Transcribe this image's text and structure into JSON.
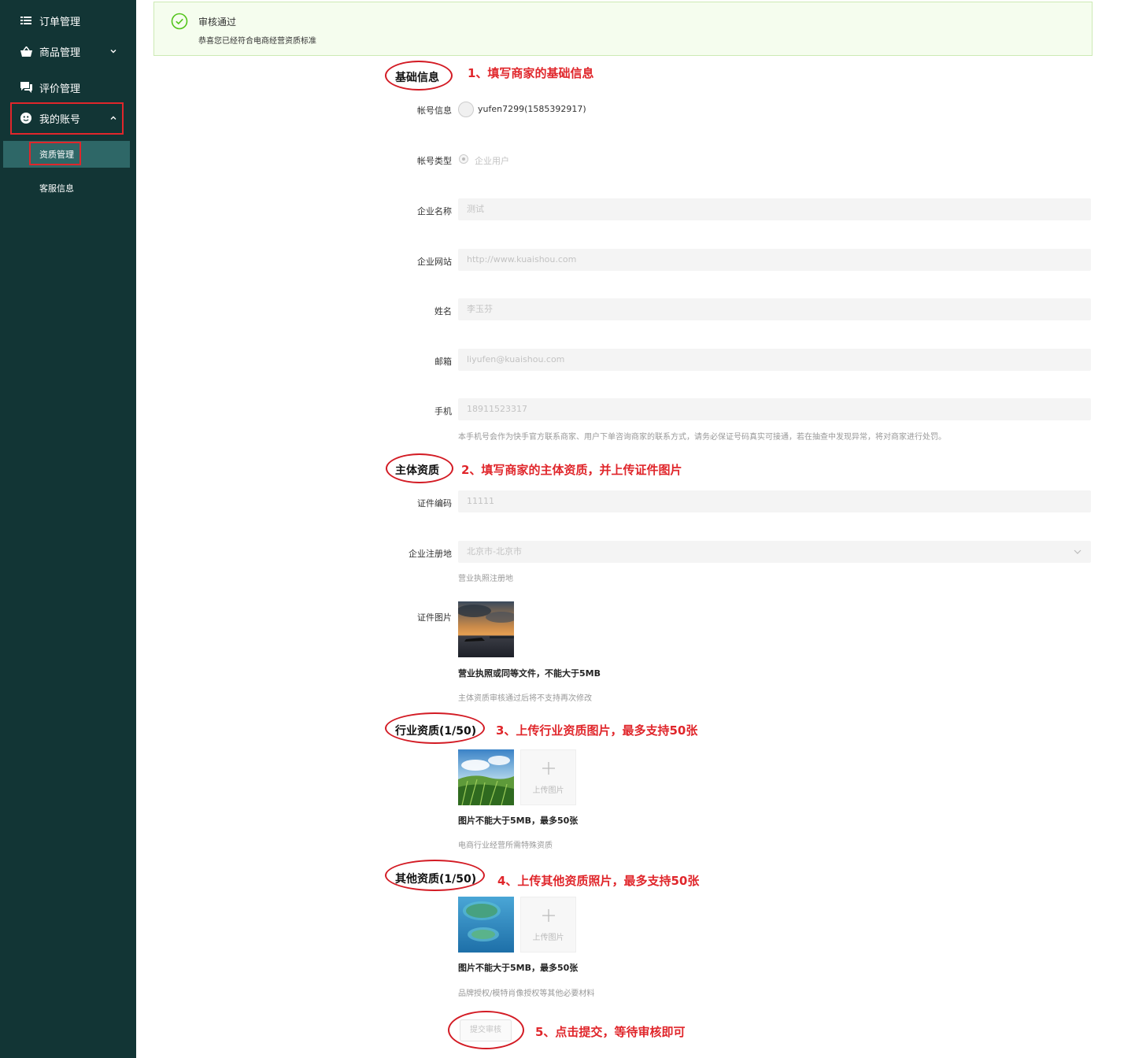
{
  "sidebar": {
    "items": [
      {
        "label": "订单管理",
        "icon": "list-icon"
      },
      {
        "label": "商品管理",
        "icon": "basket-icon"
      },
      {
        "label": "评价管理",
        "icon": "comment-icon"
      },
      {
        "label": "我的账号",
        "icon": "smiley-icon"
      }
    ],
    "subitems": [
      {
        "label": "资质管理",
        "active": true
      },
      {
        "label": "客服信息",
        "active": false
      }
    ]
  },
  "alert": {
    "title": "审核通过",
    "description": "恭喜您已经符合电商经营资质标准"
  },
  "sections": {
    "basic": {
      "title": "基础信息",
      "annotation": "1、填写商家的基础信息"
    },
    "subject": {
      "title": "主体资质",
      "annotation": "2、填写商家的主体资质，并上传证件图片"
    },
    "industry": {
      "title": "行业资质(1/50)",
      "annotation": "3、上传行业资质图片，最多支持50张"
    },
    "other": {
      "title": "其他资质(1/50)",
      "annotation": "4、上传其他资质照片，最多支持50张"
    },
    "submit": {
      "annotation": "5、点击提交，等待审核即可"
    }
  },
  "form": {
    "account_info_label": "帐号信息",
    "account_info_value": "yufen7299(1585392917)",
    "account_type_label": "帐号类型",
    "account_type_value": "企业用户",
    "company_name_label": "企业名称",
    "company_name_value": "测试",
    "company_site_label": "企业网站",
    "company_site_value": "http://www.kuaishou.com",
    "name_label": "姓名",
    "name_value": "李玉芬",
    "email_label": "邮箱",
    "email_value": "liyufen@kuaishou.com",
    "phone_label": "手机",
    "phone_value": "18911523317",
    "phone_note": "本手机号会作为快手官方联系商家、用户下单咨询商家的联系方式，请务必保证号码真实可接通，若在抽查中发现异常，将对商家进行处罚。",
    "cert_no_label": "证件编码",
    "cert_no_value": "11111",
    "reg_place_label": "企业注册地",
    "reg_place_value": "北京市-北京市",
    "reg_place_note": "营业执照注册地",
    "cert_img_label": "证件图片",
    "cert_img_note_bold": "营业执照或同等文件，不能大于5MB",
    "cert_img_note": "主体资质审核通过后将不支持再次修改",
    "industry_note_bold": "图片不能大于5MB，最多50张",
    "industry_note": "电商行业经营所需特殊资质",
    "other_note_bold": "图片不能大于5MB，最多50张",
    "other_note": "品牌授权/模特肖像授权等其他必要材料",
    "upload_text": "上传图片",
    "submit_label": "提交审核"
  },
  "colors": {
    "sidebar_bg": "#123535",
    "active_item": "#2e6767",
    "annotation_red": "#e0262b",
    "alert_bg": "#f5fdee",
    "success_green": "#52c41a"
  }
}
